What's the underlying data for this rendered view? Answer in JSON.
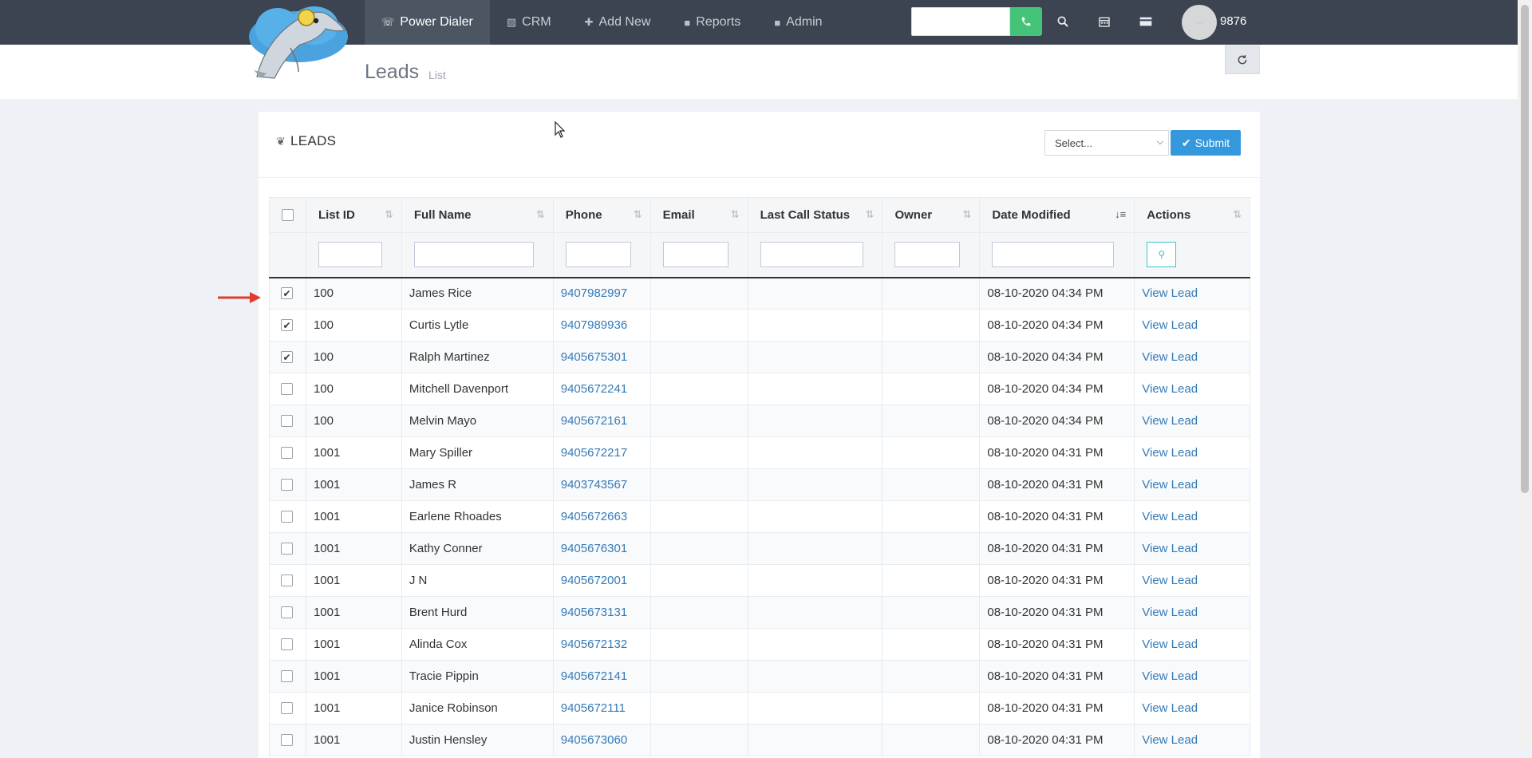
{
  "nav": {
    "items": [
      {
        "label": "Power Dialer",
        "icon": "phone-icon",
        "active": true
      },
      {
        "label": "CRM",
        "icon": "book-icon",
        "active": false
      },
      {
        "label": "Add New",
        "icon": "plus-icon",
        "active": false
      },
      {
        "label": "Reports",
        "icon": "lock-icon",
        "active": false
      },
      {
        "label": "Admin",
        "icon": "lock-icon",
        "active": false
      }
    ],
    "search_value": "",
    "extension": "9876"
  },
  "page": {
    "title": "Leads",
    "subtitle": "List"
  },
  "portlet": {
    "title": "LEADS",
    "select_placeholder": "Select...",
    "submit_label": "Submit"
  },
  "table": {
    "columns": [
      "List ID",
      "Full Name",
      "Phone",
      "Email",
      "Last Call Status",
      "Owner",
      "Date Modified",
      "Actions"
    ],
    "rows": [
      {
        "checked": true,
        "list_id": "100",
        "name": "James Rice",
        "phone": "9407982997",
        "email": "",
        "status": "",
        "owner": "",
        "date": "08-10-2020 04:34 PM",
        "action": "View Lead"
      },
      {
        "checked": true,
        "list_id": "100",
        "name": "Curtis Lytle",
        "phone": "9407989936",
        "email": "",
        "status": "",
        "owner": "",
        "date": "08-10-2020 04:34 PM",
        "action": "View Lead"
      },
      {
        "checked": true,
        "list_id": "100",
        "name": "Ralph Martinez",
        "phone": "9405675301",
        "email": "",
        "status": "",
        "owner": "",
        "date": "08-10-2020 04:34 PM",
        "action": "View Lead"
      },
      {
        "checked": false,
        "list_id": "100",
        "name": "Mitchell Davenport",
        "phone": "9405672241",
        "email": "",
        "status": "",
        "owner": "",
        "date": "08-10-2020 04:34 PM",
        "action": "View Lead"
      },
      {
        "checked": false,
        "list_id": "100",
        "name": "Melvin Mayo",
        "phone": "9405672161",
        "email": "",
        "status": "",
        "owner": "",
        "date": "08-10-2020 04:34 PM",
        "action": "View Lead"
      },
      {
        "checked": false,
        "list_id": "1001",
        "name": "Mary Spiller",
        "phone": "9405672217",
        "email": "",
        "status": "",
        "owner": "",
        "date": "08-10-2020 04:31 PM",
        "action": "View Lead"
      },
      {
        "checked": false,
        "list_id": "1001",
        "name": "James R",
        "phone": "9403743567",
        "email": "",
        "status": "",
        "owner": "",
        "date": "08-10-2020 04:31 PM",
        "action": "View Lead"
      },
      {
        "checked": false,
        "list_id": "1001",
        "name": "Earlene Rhoades",
        "phone": "9405672663",
        "email": "",
        "status": "",
        "owner": "",
        "date": "08-10-2020 04:31 PM",
        "action": "View Lead"
      },
      {
        "checked": false,
        "list_id": "1001",
        "name": "Kathy Conner",
        "phone": "9405676301",
        "email": "",
        "status": "",
        "owner": "",
        "date": "08-10-2020 04:31 PM",
        "action": "View Lead"
      },
      {
        "checked": false,
        "list_id": "1001",
        "name": "J N",
        "phone": "9405672001",
        "email": "",
        "status": "",
        "owner": "",
        "date": "08-10-2020 04:31 PM",
        "action": "View Lead"
      },
      {
        "checked": false,
        "list_id": "1001",
        "name": "Brent Hurd",
        "phone": "9405673131",
        "email": "",
        "status": "",
        "owner": "",
        "date": "08-10-2020 04:31 PM",
        "action": "View Lead"
      },
      {
        "checked": false,
        "list_id": "1001",
        "name": "Alinda Cox",
        "phone": "9405672132",
        "email": "",
        "status": "",
        "owner": "",
        "date": "08-10-2020 04:31 PM",
        "action": "View Lead"
      },
      {
        "checked": false,
        "list_id": "1001",
        "name": "Tracie Pippin",
        "phone": "9405672141",
        "email": "",
        "status": "",
        "owner": "",
        "date": "08-10-2020 04:31 PM",
        "action": "View Lead"
      },
      {
        "checked": false,
        "list_id": "1001",
        "name": "Janice Robinson",
        "phone": "9405672111",
        "email": "",
        "status": "",
        "owner": "",
        "date": "08-10-2020 04:31 PM",
        "action": "View Lead"
      },
      {
        "checked": false,
        "list_id": "1001",
        "name": "Justin Hensley",
        "phone": "9405673060",
        "email": "",
        "status": "",
        "owner": "",
        "date": "08-10-2020 04:31 PM",
        "action": "View Lead"
      }
    ]
  },
  "colors": {
    "navbar": "#3b4450",
    "active_nav": "#4c5663",
    "call_button": "#45c479",
    "submit_button": "#3598dc",
    "link": "#337ab7",
    "annotation_arrow": "#e03c31"
  }
}
